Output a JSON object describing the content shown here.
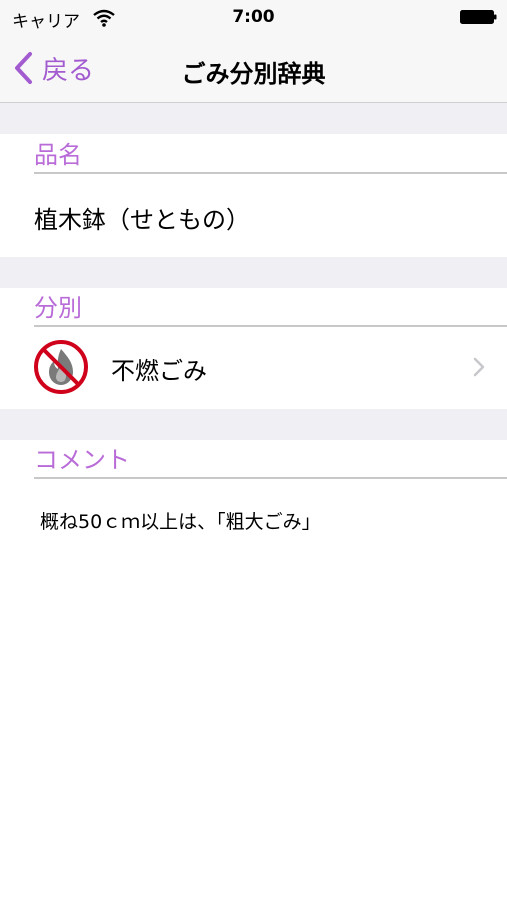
{
  "status_bar": {
    "carrier": "キャリア",
    "time": "7:00",
    "icons": [
      "wifi-icon",
      "battery-icon"
    ]
  },
  "nav": {
    "back_label": "戻る",
    "title": "ごみ分別辞典",
    "accent_color": "#a35bd0"
  },
  "sections": {
    "name_header": "品名",
    "name_value": "植木鉢（せともの）",
    "category_header": "分別",
    "category_value": "不燃ごみ",
    "category_icon": "non-burnable-icon",
    "comment_header": "コメント",
    "comment_value": "概ね50ｃｍ以上は、「粗大ごみ」"
  },
  "colors": {
    "header_text": "#b96bd8",
    "section_gap": "#efeff4",
    "prohibition_red": "#d0021b"
  }
}
